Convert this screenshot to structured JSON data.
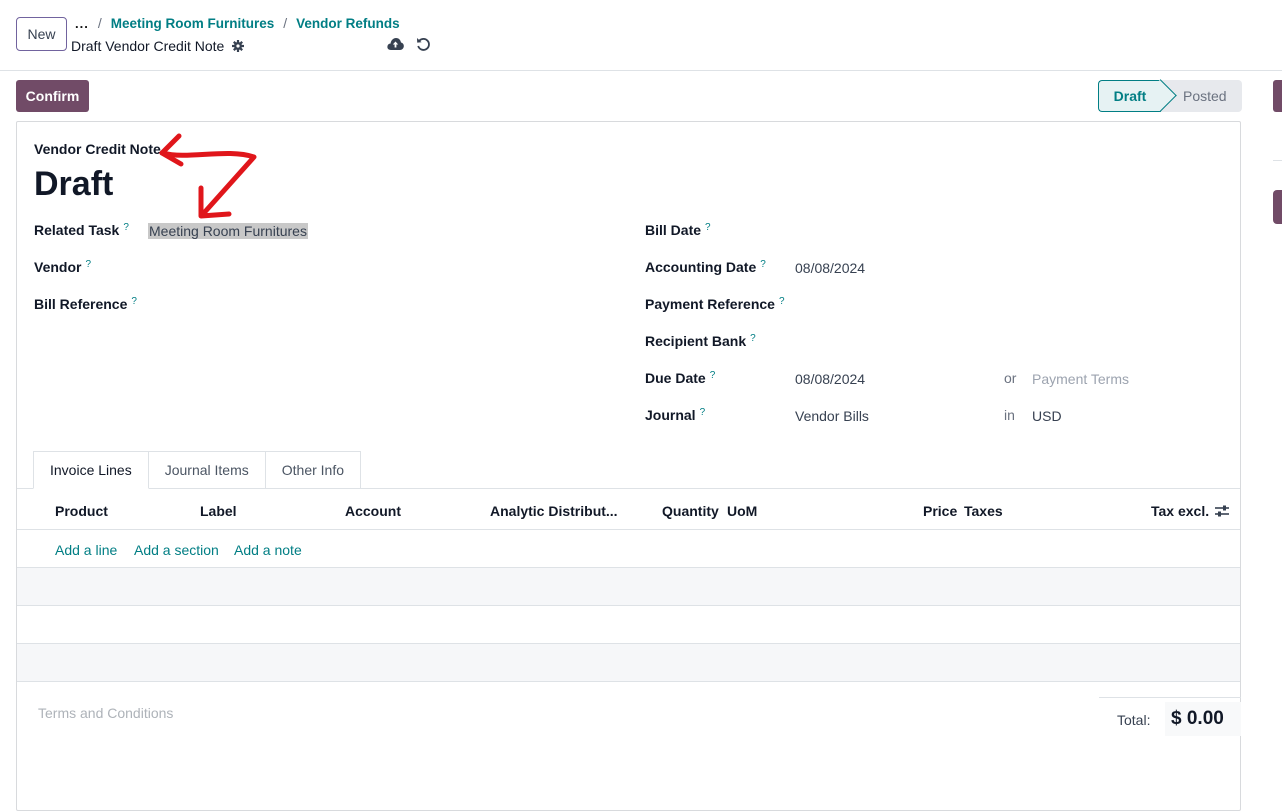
{
  "topbar": {
    "new_label": "New",
    "breadcrumb_more": "...",
    "breadcrumb": [
      "Meeting Room Furnitures",
      "Vendor Refunds"
    ],
    "record_title": "Draft Vendor Credit Note"
  },
  "actions": {
    "confirm_label": "Confirm"
  },
  "status": {
    "current": "Draft",
    "next": "Posted"
  },
  "form": {
    "doc_type": "Vendor Credit Note",
    "doc_name": "Draft",
    "left": {
      "related_task_label": "Related Task",
      "related_task_value": "Meeting Room Furnitures",
      "vendor_label": "Vendor",
      "bill_reference_label": "Bill Reference"
    },
    "right": {
      "bill_date_label": "Bill Date",
      "accounting_date_label": "Accounting Date",
      "accounting_date_value": "08/08/2024",
      "payment_reference_label": "Payment Reference",
      "recipient_bank_label": "Recipient Bank",
      "due_date_label": "Due Date",
      "due_date_value": "08/08/2024",
      "or_text": "or",
      "payment_terms_placeholder": "Payment Terms",
      "journal_label": "Journal",
      "journal_value": "Vendor Bills",
      "in_text": "in",
      "currency_value": "USD"
    },
    "help_mark": "?"
  },
  "tabs": [
    "Invoice Lines",
    "Journal Items",
    "Other Info"
  ],
  "table": {
    "columns": [
      "Product",
      "Label",
      "Account",
      "Analytic Distribut...",
      "Quantity",
      "UoM",
      "Price",
      "Taxes",
      "Tax excl."
    ],
    "add_links": [
      "Add a line",
      "Add a section",
      "Add a note"
    ]
  },
  "footer": {
    "terms_placeholder": "Terms and Conditions",
    "total_label": "Total:",
    "total_value": "$ 0.00"
  },
  "colors": {
    "brand": "#714b67",
    "link": "#017e84",
    "annotation": "#e0161b"
  }
}
